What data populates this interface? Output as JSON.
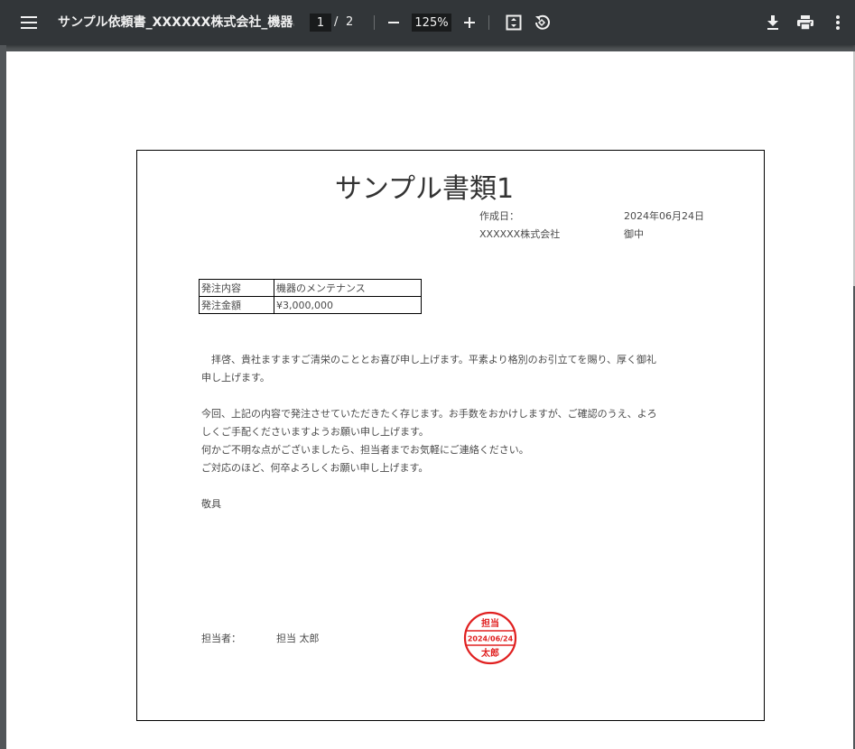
{
  "toolbar": {
    "title": "サンプル依頼書_XXXXXX株式会社_機器...",
    "current_page": "1",
    "page_separator": "/",
    "total_pages": "2",
    "zoom": "125%",
    "icons": [
      "menu-icon",
      "zoom-out-icon",
      "zoom-in-icon",
      "fit-page-icon",
      "rotate-icon",
      "download-icon",
      "print-icon",
      "more-vert-icon"
    ]
  },
  "document": {
    "heading": "サンプル書類1",
    "date_label": "作成日：",
    "date_value": "2024年06月24日",
    "recipient": "XXXXXX株式会社",
    "honorific": "御中",
    "table": [
      {
        "label": "発注内容",
        "value": "機器のメンテナンス"
      },
      {
        "label": "発注金額",
        "value": "¥3,000,000"
      }
    ],
    "paragraphs": [
      [
        "拝啓、貴社ますますご清栄のこととお喜び申し上げます。平素より格別のお引立てを賜り、厚く御礼",
        "申し上げます。"
      ],
      [
        "今回、上記の内容で発注させていただきたく存じます。お手数をおかけしますが、ご確認のうえ、よろ",
        "しくご手配くださいますようお願い申し上げます。",
        "何かご不明な点がございましたら、担当者までお気軽にご連絡ください。",
        "ご対応のほど、何卒よろしくお願い申し上げます。"
      ],
      [
        "敬具"
      ]
    ],
    "person_label": "担当者：",
    "person_name": "担当 太郎",
    "stamp": {
      "top": "担当",
      "date": "2024/06/24",
      "bottom": "太郎",
      "color": "#e02020"
    }
  }
}
